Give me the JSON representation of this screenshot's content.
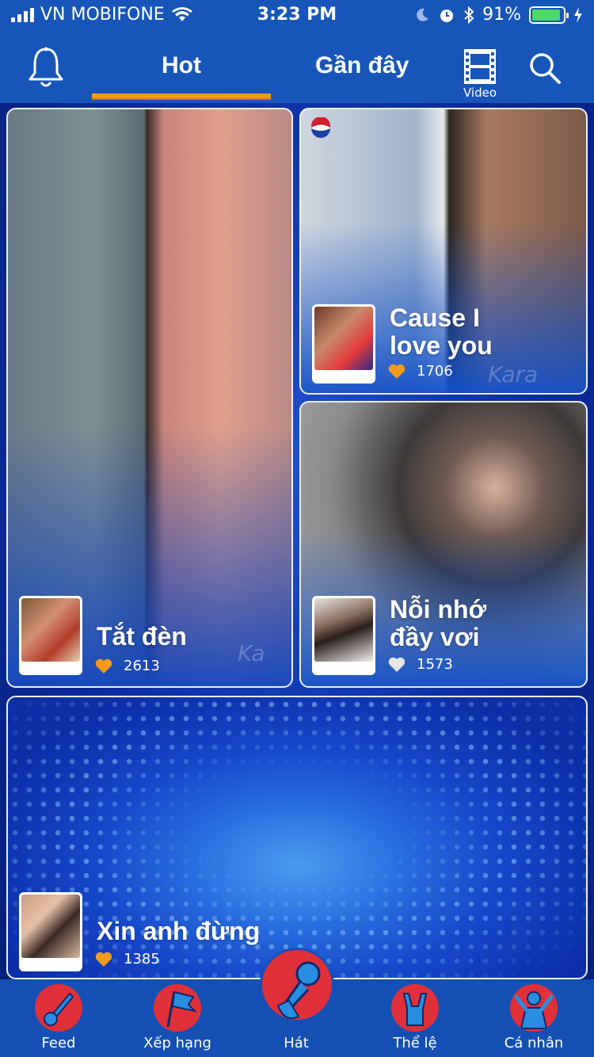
{
  "status_bar": {
    "carrier": "VN MOBIFONE",
    "time": "3:23 PM",
    "battery": "91%",
    "battery_level": 0.91
  },
  "header": {
    "tabs": [
      "Hot",
      "Gần đây"
    ],
    "active_tab": "Hot",
    "video_label": "Video",
    "icons": [
      "bell-icon",
      "video-icon",
      "search-icon"
    ]
  },
  "cards": [
    {
      "title": "Tắt đèn",
      "likes": "2613",
      "heart_color": "#f39a1e"
    },
    {
      "title": "Cause I love you",
      "likes": "1706",
      "heart_color": "#f39a1e"
    },
    {
      "title": "Nỗi nhớ đầy vơi",
      "likes": "1573",
      "heart_color": "#e6e6e6"
    },
    {
      "title": "Xin anh đừng",
      "likes": "1385",
      "heart_color": "#f39a1e"
    }
  ],
  "bottom_nav": [
    {
      "label": "Feed"
    },
    {
      "label": "Xếp hạng"
    },
    {
      "label": "Hát"
    },
    {
      "label": "Thể lệ"
    },
    {
      "label": "Cá nhân"
    }
  ],
  "colors": {
    "header_bg": "#1756b8",
    "accent": "#f39a1e",
    "nav_icon_bg": "#e0303a"
  }
}
